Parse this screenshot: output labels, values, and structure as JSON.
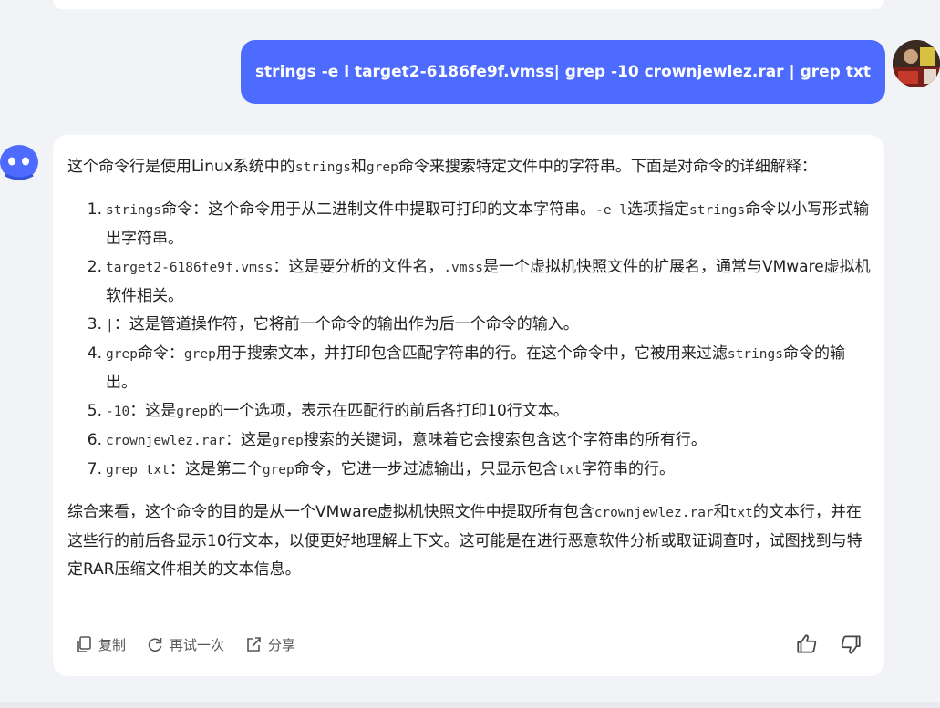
{
  "user_message": {
    "text": "strings -e l  target2-6186fe9f.vmss| grep -10 crownjewlez.rar | grep txt"
  },
  "answer": {
    "intro": [
      "这个命令行是使用Linux系统中的",
      "strings",
      "和",
      "grep",
      "命令来搜索特定文件中的字符串。下面是对命令的详细解释："
    ],
    "items": [
      {
        "num": "1.",
        "parts": [
          [
            "mono",
            "strings"
          ],
          [
            "text",
            "命令：这个命令用于从二进制文件中提取可打印的文本字符串。"
          ],
          [
            "mono",
            "-e l"
          ],
          [
            "text",
            "选项指定"
          ],
          [
            "mono",
            "strings"
          ],
          [
            "text",
            "命令以小写形式输出字符串。"
          ]
        ]
      },
      {
        "num": "2.",
        "parts": [
          [
            "mono",
            "target2-6186fe9f.vmss"
          ],
          [
            "text",
            "：这是要分析的文件名，"
          ],
          [
            "mono",
            ".vmss"
          ],
          [
            "text",
            "是一个虚拟机快照文件的扩展名，通常与VMware虚拟机软件相关。"
          ]
        ]
      },
      {
        "num": "3.",
        "parts": [
          [
            "mono",
            "|"
          ],
          [
            "text",
            "：这是管道操作符，它将前一个命令的输出作为后一个命令的输入。"
          ]
        ]
      },
      {
        "num": "4.",
        "parts": [
          [
            "mono",
            "grep"
          ],
          [
            "text",
            "命令："
          ],
          [
            "mono",
            "grep"
          ],
          [
            "text",
            "用于搜索文本，并打印包含匹配字符串的行。在这个命令中，它被用来过滤"
          ],
          [
            "mono",
            "strings"
          ],
          [
            "text",
            "命令的输出。"
          ]
        ]
      },
      {
        "num": "5.",
        "parts": [
          [
            "mono",
            "-10"
          ],
          [
            "text",
            "：这是"
          ],
          [
            "mono",
            "grep"
          ],
          [
            "text",
            "的一个选项，表示在匹配行的前后各打印10行文本。"
          ]
        ]
      },
      {
        "num": "6.",
        "parts": [
          [
            "mono",
            "crownjewlez.rar"
          ],
          [
            "text",
            "：这是"
          ],
          [
            "mono",
            "grep"
          ],
          [
            "text",
            "搜索的关键词，意味着它会搜索包含这个字符串的所有行。"
          ]
        ]
      },
      {
        "num": "7.",
        "parts": [
          [
            "mono",
            "grep txt"
          ],
          [
            "text",
            "：这是第二个"
          ],
          [
            "mono",
            "grep"
          ],
          [
            "text",
            "命令，它进一步过滤输出，只显示包含"
          ],
          [
            "mono",
            "txt"
          ],
          [
            "text",
            "字符串的行。"
          ]
        ]
      }
    ],
    "summary": [
      "综合来看，这个命令的目的是从一个VMware虚拟机快照文件中提取所有包含",
      "crownjewlez.rar",
      "和",
      "txt",
      "的文本行，并在这些行的前后各显示10行文本，以便更好地理解上下文。这可能是在进行恶意软件分析或取证调查时，试图找到与特定RAR压缩文件相关的文本信息。"
    ]
  },
  "actions": {
    "copy": "复制",
    "retry": "再试一次",
    "share": "分享"
  },
  "icons": {
    "copy": "copy-icon",
    "retry": "refresh-icon",
    "share": "share-icon",
    "like": "thumbs-up-icon",
    "dislike": "thumbs-down-icon",
    "bot": "robot-avatar-icon"
  },
  "colors": {
    "user_bubble": "#4d6bfe",
    "bot_avatar": "#4d6bfe",
    "background": "#f1f3f7"
  }
}
